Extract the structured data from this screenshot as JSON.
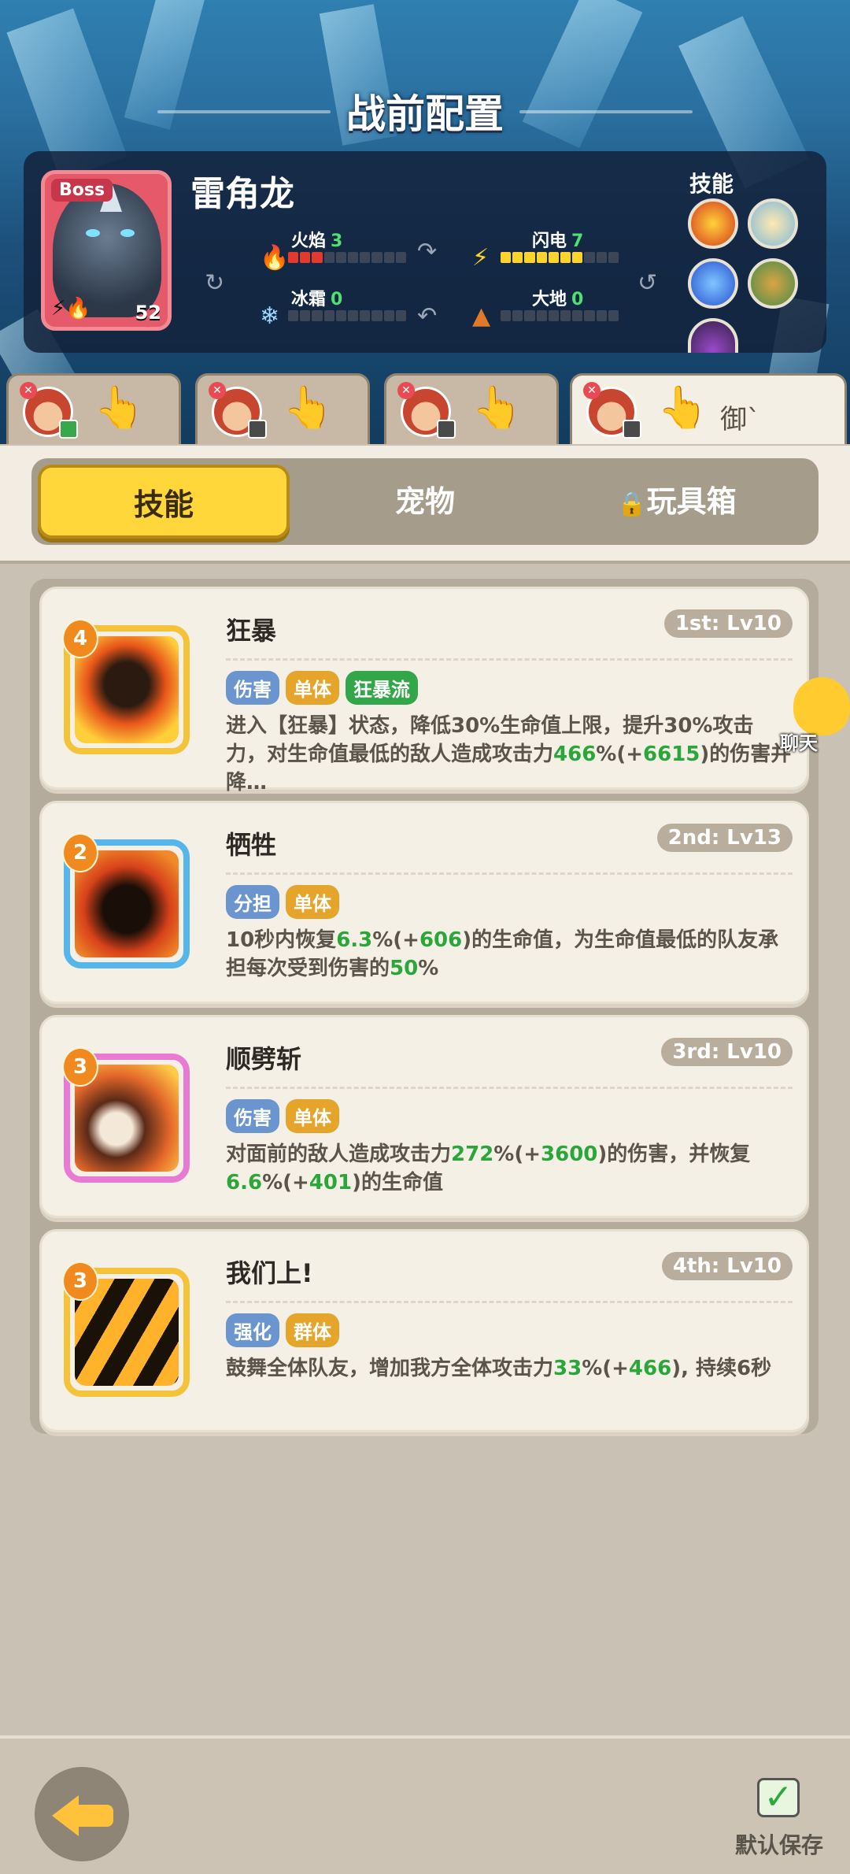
{
  "header": {
    "title": "战前配置"
  },
  "boss": {
    "tag": "Boss",
    "name": "雷角龙",
    "level": "52",
    "stats": {
      "fire": {
        "label": "火焰",
        "value": "3",
        "filled": 3
      },
      "lightning": {
        "label": "闪电",
        "value": "7",
        "filled": 7
      },
      "frost": {
        "label": "冰霜",
        "value": "0",
        "filled": 0
      },
      "earth": {
        "label": "大地",
        "value": "0",
        "filled": 0
      }
    },
    "skills_label": "技能"
  },
  "character_tabs": [
    {
      "active": false,
      "badge": "green"
    },
    {
      "active": false,
      "badge": "dark"
    },
    {
      "active": false,
      "badge": "dark"
    },
    {
      "active": true,
      "badge": "dark",
      "text": "御`"
    }
  ],
  "segment": {
    "skills": "技能",
    "pets": "宠物",
    "toybox": "玩具箱"
  },
  "skills": [
    {
      "drop": "4",
      "name": "狂暴",
      "lv": "1st: Lv10",
      "tags": [
        {
          "t": "伤害",
          "c": "blue"
        },
        {
          "t": "单体",
          "c": "orange"
        },
        {
          "t": "狂暴流",
          "c": "green"
        }
      ],
      "desc": [
        "进入【狂暴】状态，降低30%生命值上限，提升30%攻击力，对生命值最低的敌人造成攻击力",
        "466",
        "%(+",
        "6615",
        ")的伤害并降…"
      ],
      "color": "yellow"
    },
    {
      "drop": "2",
      "name": "牺牲",
      "lv": "2nd: Lv13",
      "tags": [
        {
          "t": "分担",
          "c": "blue"
        },
        {
          "t": "单体",
          "c": "orange"
        }
      ],
      "desc": [
        "10秒内恢复",
        "6.3",
        "%(+",
        "606",
        ")的生命值，为生命值最低的队友承担每次受到伤害的",
        "50",
        "%"
      ],
      "color": "blue"
    },
    {
      "drop": "3",
      "name": "顺劈斩",
      "lv": "3rd: Lv10",
      "tags": [
        {
          "t": "伤害",
          "c": "blue"
        },
        {
          "t": "单体",
          "c": "orange"
        }
      ],
      "desc": [
        "对面前的敌人造成攻击力",
        "272",
        "%(+",
        "3600",
        ")的伤害，并恢复",
        "6.6",
        "%(+",
        "401",
        ")的生命值"
      ],
      "color": "pink"
    },
    {
      "drop": "3",
      "name": "我们上!",
      "lv": "4th: Lv10",
      "tags": [
        {
          "t": "强化",
          "c": "blue"
        },
        {
          "t": "群体",
          "c": "orange"
        }
      ],
      "desc": [
        "鼓舞全体队友，增加我方全体攻击力",
        "33",
        "%(+",
        "466",
        "), 持续6秒"
      ],
      "color": "yellow"
    }
  ],
  "chat": {
    "label": "聊天"
  },
  "footer": {
    "save_label": "默认保存"
  }
}
